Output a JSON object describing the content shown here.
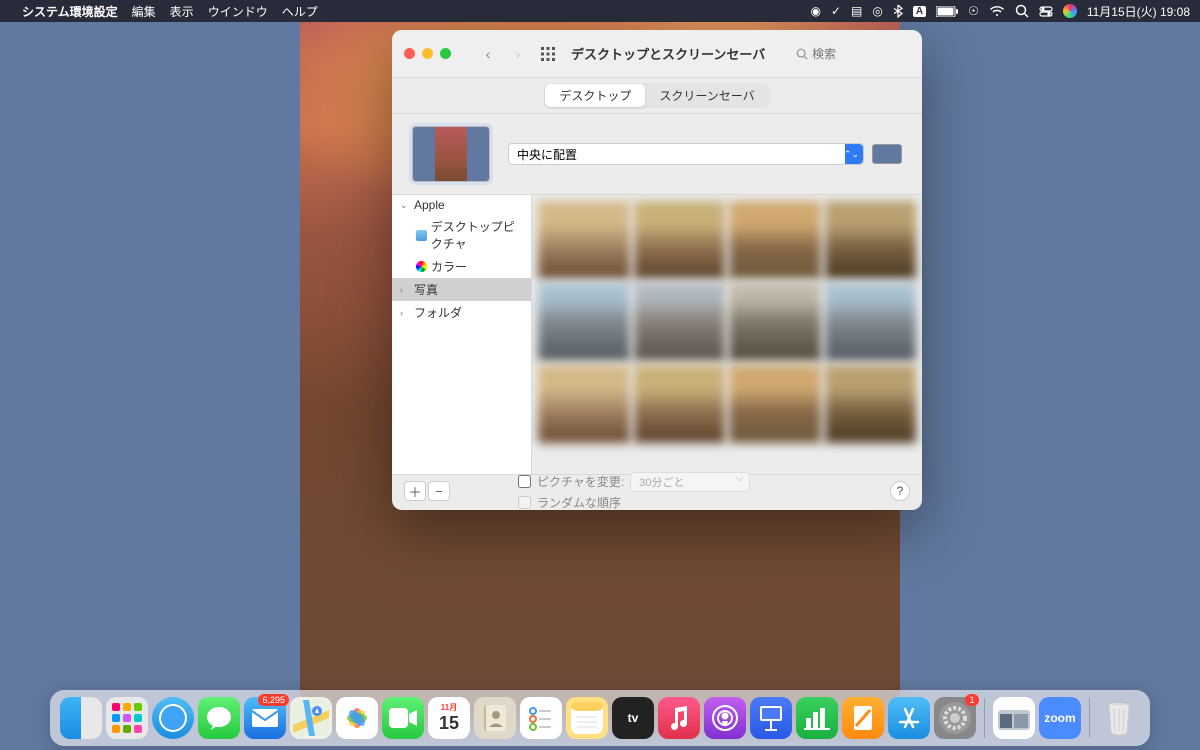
{
  "menubar": {
    "app_name": "システム環境設定",
    "items": [
      "編集",
      "表示",
      "ウインドウ",
      "ヘルプ"
    ],
    "datetime": "11月15日(火) 19:08"
  },
  "window": {
    "title": "デスクトップとスクリーンセーバ",
    "search_placeholder": "検索",
    "tabs": {
      "desktop": "デスクトップ",
      "screensaver": "スクリーンセーバ"
    },
    "fit_mode": "中央に配置",
    "fill_color": "#6179a0",
    "sidebar": {
      "apple": "Apple",
      "desktop_pictures": "デスクトップピクチャ",
      "colors": "カラー",
      "photos": "写真",
      "folders": "フォルダ"
    },
    "footer": {
      "change_picture": "ピクチャを変更:",
      "interval": "30分ごと",
      "random": "ランダムな順序"
    }
  },
  "dock": {
    "mail_badge": "6,295",
    "prefs_badge": "1",
    "calendar_month": "11月",
    "calendar_day": "15",
    "zoom_label": "zoom"
  }
}
